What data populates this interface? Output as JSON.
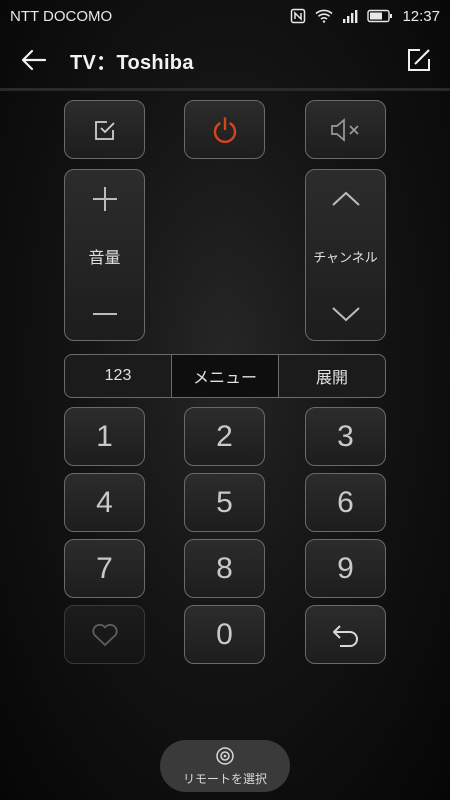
{
  "status_bar": {
    "carrier": "NTT DOCOMO",
    "time": "12:37",
    "icons": [
      "nfc-icon",
      "wifi-icon",
      "signal-icon",
      "battery-icon"
    ]
  },
  "header": {
    "title": "TV：Toshiba",
    "back_icon": "arrow-left-icon",
    "edit_icon": "edit-icon"
  },
  "controls": {
    "top_row_icons": [
      "input-select-icon",
      "power-icon",
      "mute-icon"
    ],
    "volume": {
      "label": "音量"
    },
    "channel": {
      "label": "チャンネル"
    },
    "accent_color": "#d9441f"
  },
  "tabs": [
    {
      "label": "123"
    },
    {
      "label": "メニュー"
    },
    {
      "label": "展開"
    }
  ],
  "active_tab": "メニュー",
  "keypad": [
    "1",
    "2",
    "3",
    "4",
    "5",
    "6",
    "7",
    "8",
    "9",
    "0"
  ],
  "keypad_extra_icons": [
    "favorite-icon",
    "return-icon"
  ],
  "bottom": {
    "select_remote_label": "リモートを選択",
    "select_remote_icon": "remote-select-icon"
  }
}
